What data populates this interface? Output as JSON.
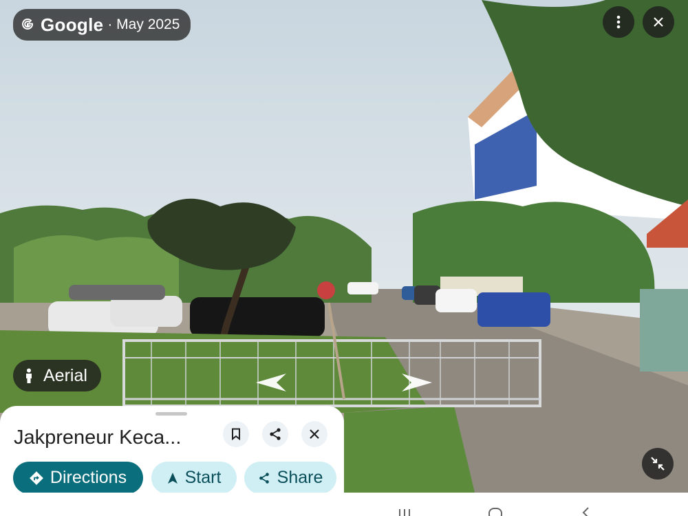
{
  "header": {
    "brand": "Google",
    "date": "· May 2025"
  },
  "overlay": {
    "aerial_label": "Aerial"
  },
  "place_card": {
    "title": "Jakpreneur Keca...",
    "directions_label": "Directions",
    "start_label": "Start",
    "share_label": "Share"
  },
  "icons": {
    "google_logo": "google-g-icon",
    "more": "more-vert-icon",
    "close": "close-icon",
    "person": "person-icon",
    "save": "bookmark-icon",
    "share": "share-icon",
    "directions": "directions-icon",
    "navigate": "navigation-icon",
    "collapse": "collapse-icon",
    "arrow_left": "arrow-left-icon",
    "arrow_right": "arrow-right-icon"
  },
  "colors": {
    "teal": "#0b6e7c",
    "teal_light": "#cfeff5",
    "overlay": "#282828"
  }
}
